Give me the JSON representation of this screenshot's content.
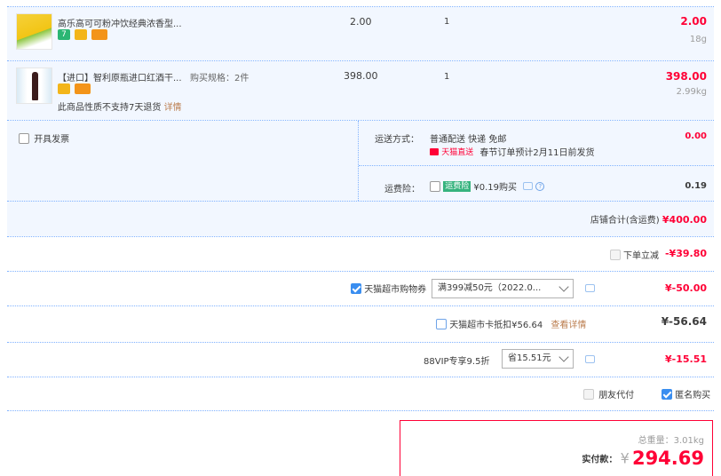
{
  "items": [
    {
      "name": "高乐高可可粉冲饮经典浓香型...",
      "spec": "",
      "price": "2.00",
      "qty": "1",
      "subtotal": "2.00",
      "weight": "18g"
    },
    {
      "name": "【进口】智利原瓶进口红酒干...",
      "spec": "购买规格：2件",
      "price": "398.00",
      "qty": "1",
      "subtotal": "398.00",
      "weight": "2.99kg",
      "notice": "此商品性质不支持7天退货",
      "notice_link": "详情"
    }
  ],
  "invoice": {
    "label": "开具发票"
  },
  "shipping": {
    "label": "运送方式：",
    "method": "普通配送 快递 免邮",
    "badge": "天猫直送",
    "note": "春节订单预计2月11日前发货",
    "cost": "0.00"
  },
  "insurance": {
    "label": "运费险：",
    "badge": "运费险",
    "price": "¥0.19购买",
    "cost": "0.19"
  },
  "store_total": {
    "label": "店铺合计(含运费)",
    "value": "¥400.00"
  },
  "discounts": {
    "instant": {
      "label": "下单立减",
      "value": "-¥39.80"
    },
    "coupon": {
      "label": "天猫超市购物券",
      "option": "满399减50元（2022.0...",
      "value": "¥-50.00"
    },
    "card": {
      "label": "天猫超市卡抵扣¥56.64",
      "link": "查看详情",
      "value": "¥-56.64"
    },
    "vip": {
      "label": "88VIP专享9.5折",
      "option": "省15.51元",
      "value": "¥-15.51"
    }
  },
  "options": {
    "friend_pay": "朋友代付",
    "anonymous": "匿名购买"
  },
  "summary": {
    "weight_label": "总重量：",
    "weight": "3.01kg",
    "pay_label": "实付款：",
    "currency": "¥",
    "amount": "294.69"
  },
  "colors": {
    "accent_red": "#ff0036",
    "checkbox_blue": "#3a8ef0",
    "light_blue_bg": "#f2f7ff"
  }
}
